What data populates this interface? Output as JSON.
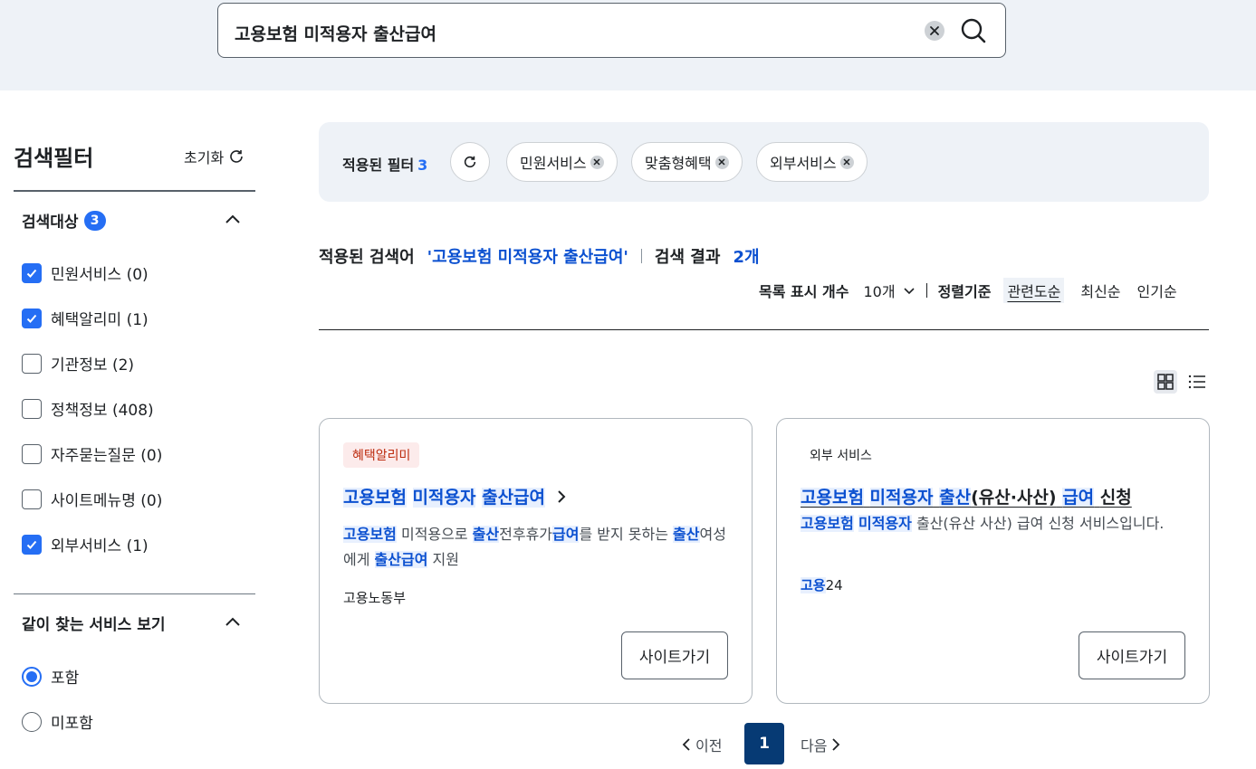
{
  "search": {
    "query": "고용보험 미적용자 출산급여"
  },
  "sidebar": {
    "title": "검색필터",
    "reset_label": "초기화",
    "section1": {
      "title": "검색대상",
      "count": "3",
      "items": [
        {
          "label": "민원서비스 (0)",
          "checked": true
        },
        {
          "label": "혜택알리미 (1)",
          "checked": true
        },
        {
          "label": "기관정보 (2)",
          "checked": false
        },
        {
          "label": "정책정보 (408)",
          "checked": false
        },
        {
          "label": "자주묻는질문 (0)",
          "checked": false
        },
        {
          "label": "사이트메뉴명 (0)",
          "checked": false
        },
        {
          "label": "외부서비스 (1)",
          "checked": true
        }
      ]
    },
    "section2": {
      "title": "같이 찾는 서비스 보기",
      "options": [
        {
          "label": "포함",
          "selected": true
        },
        {
          "label": "미포함",
          "selected": false
        }
      ]
    }
  },
  "filters": {
    "label": "적용된 필터",
    "count": "3",
    "chips": [
      "민원서비스",
      "맞춤형혜택",
      "외부서비스"
    ]
  },
  "results": {
    "query_label": "적용된 검색어",
    "query_quoted": "'고용보험 미적용자 출산급여'",
    "count_label": "검색 결과",
    "count_value": "2개"
  },
  "list_controls": {
    "page_size_label": "목록 표시 개수",
    "page_size_value": "10개",
    "sort_label": "정렬기준",
    "sort_options": [
      "관련도순",
      "최신순",
      "인기순"
    ],
    "active_sort": "관련도순"
  },
  "cards": [
    {
      "tag": "혜택알리미",
      "title_parts": [
        "고용보험",
        "미적용자",
        "출산급여"
      ],
      "desc_parts": [
        "고용보험",
        " 미적용으로 ",
        "출산",
        "전후휴가",
        "급여",
        "를 받지 못하는 ",
        "출산",
        "여성에게 ",
        "출산급여",
        " 지원"
      ],
      "org": "고용노동부",
      "button": "사이트가기"
    },
    {
      "tag": "외부 서비스",
      "title_parts": [
        "고용보험",
        "미적용자",
        "출산",
        "(유산·사산)",
        "급여",
        "신청"
      ],
      "desc_parts": [
        "고용보험",
        " ",
        "미적용자",
        " 출산(유산 사산) 급여 신청 서비스입니다."
      ],
      "org_parts": [
        "고용",
        "24"
      ],
      "button": "사이트가기"
    }
  ],
  "pagination": {
    "prev": "이전",
    "current": "1",
    "next": "다음"
  },
  "colors": {
    "accent": "#256ef4",
    "highlight_text": "#0b50d0",
    "page_active": "#063a74",
    "tag_pink_bg": "#fcebeb"
  }
}
